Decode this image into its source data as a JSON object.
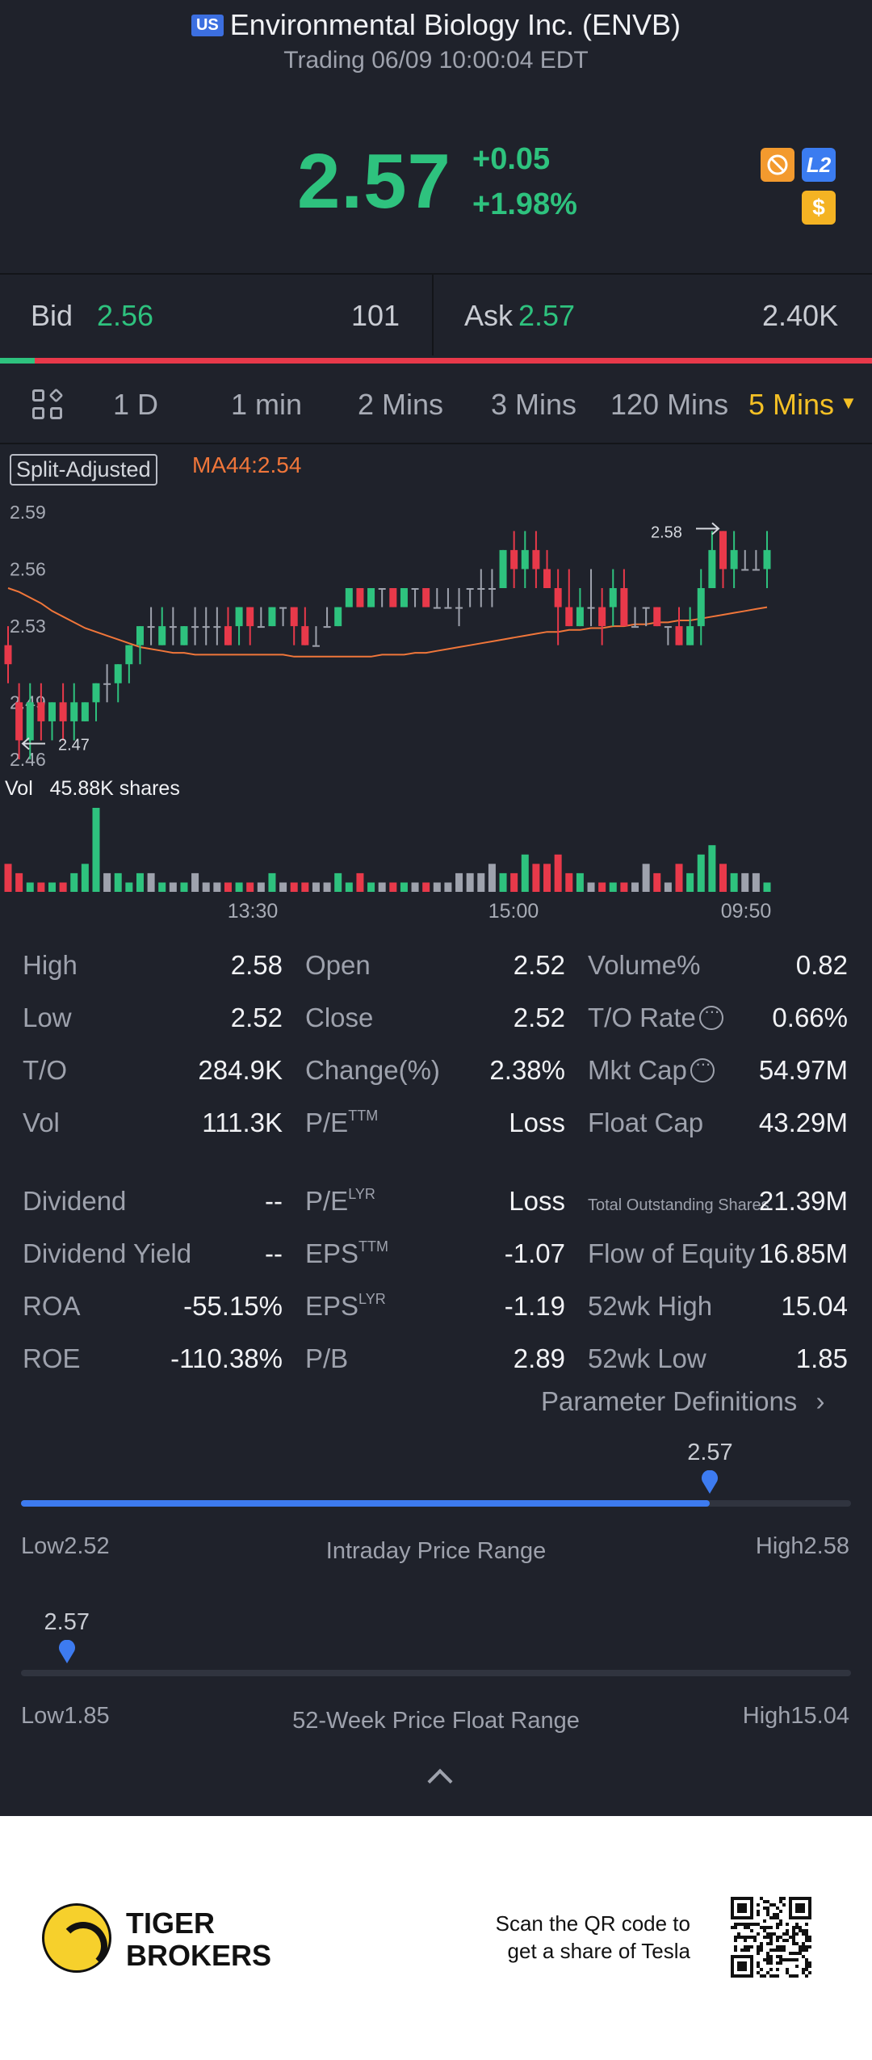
{
  "header": {
    "market_badge": "US",
    "title": "Environmental Biology Inc. (ENVB)",
    "status": "Trading 06/09 10:00:04 EDT"
  },
  "quote": {
    "price": "2.57",
    "change": "+0.05",
    "change_pct": "+1.98%",
    "badges": [
      "no-short-icon",
      "L2",
      "$"
    ],
    "colors": {
      "up": "#2ec27e",
      "down": "#e8394a",
      "accent": "#f4c025"
    }
  },
  "bid_ask": {
    "bid_label": "Bid",
    "bid_price": "2.56",
    "bid_size": "101",
    "ask_label": "Ask",
    "ask_price": "2.57",
    "ask_size": "2.40K",
    "bid_ratio": 0.04
  },
  "tabs": [
    {
      "label": "1 D",
      "active": false
    },
    {
      "label": "1 min",
      "active": false
    },
    {
      "label": "2 Mins",
      "active": false
    },
    {
      "label": "3 Mins",
      "active": false
    },
    {
      "label": "120 Mins",
      "active": false
    },
    {
      "label": "5 Mins",
      "active": true
    }
  ],
  "chart": {
    "split_label": "Split-Adjusted",
    "ma_label": "MA44:2.54",
    "vol_label": "Vol",
    "vol_value": "45.88K shares",
    "max_label": "2.58",
    "min_label": "2.47"
  },
  "chart_data": {
    "type": "candlestick",
    "y_ticks": [
      "2.59",
      "2.56",
      "2.53",
      "2.49",
      "2.46"
    ],
    "ylim": [
      2.46,
      2.595
    ],
    "x_ticks": [
      "13:30",
      "15:00",
      "09:50"
    ],
    "candles": [
      [
        2.52,
        2.51,
        2.53,
        2.5
      ],
      [
        2.49,
        2.47,
        2.5,
        2.46
      ],
      [
        2.47,
        2.49,
        2.5,
        2.46
      ],
      [
        2.49,
        2.48,
        2.5,
        2.47
      ],
      [
        2.48,
        2.49,
        2.49,
        2.47
      ],
      [
        2.49,
        2.48,
        2.5,
        2.47
      ],
      [
        2.48,
        2.49,
        2.5,
        2.47
      ],
      [
        2.48,
        2.49,
        2.49,
        2.48
      ],
      [
        2.49,
        2.5,
        2.5,
        2.48
      ],
      [
        2.5,
        2.5,
        2.51,
        2.49
      ],
      [
        2.5,
        2.51,
        2.51,
        2.49
      ],
      [
        2.51,
        2.52,
        2.52,
        2.5
      ],
      [
        2.52,
        2.53,
        2.53,
        2.51
      ],
      [
        2.53,
        2.53,
        2.54,
        2.52
      ],
      [
        2.52,
        2.53,
        2.54,
        2.52
      ],
      [
        2.53,
        2.53,
        2.54,
        2.52
      ],
      [
        2.52,
        2.53,
        2.53,
        2.52
      ],
      [
        2.53,
        2.53,
        2.54,
        2.52
      ],
      [
        2.53,
        2.53,
        2.54,
        2.52
      ],
      [
        2.53,
        2.53,
        2.54,
        2.52
      ],
      [
        2.53,
        2.52,
        2.54,
        2.52
      ],
      [
        2.53,
        2.54,
        2.54,
        2.52
      ],
      [
        2.54,
        2.53,
        2.54,
        2.52
      ],
      [
        2.53,
        2.53,
        2.54,
        2.53
      ],
      [
        2.53,
        2.54,
        2.54,
        2.53
      ],
      [
        2.54,
        2.54,
        2.54,
        2.53
      ],
      [
        2.54,
        2.53,
        2.54,
        2.52
      ],
      [
        2.53,
        2.52,
        2.54,
        2.52
      ],
      [
        2.52,
        2.52,
        2.53,
        2.52
      ],
      [
        2.53,
        2.53,
        2.54,
        2.53
      ],
      [
        2.53,
        2.54,
        2.54,
        2.53
      ],
      [
        2.54,
        2.55,
        2.55,
        2.54
      ],
      [
        2.55,
        2.54,
        2.55,
        2.54
      ],
      [
        2.54,
        2.55,
        2.55,
        2.54
      ],
      [
        2.55,
        2.55,
        2.55,
        2.54
      ],
      [
        2.55,
        2.54,
        2.55,
        2.54
      ],
      [
        2.54,
        2.55,
        2.55,
        2.54
      ],
      [
        2.55,
        2.55,
        2.55,
        2.54
      ],
      [
        2.55,
        2.54,
        2.55,
        2.54
      ],
      [
        2.54,
        2.54,
        2.55,
        2.54
      ],
      [
        2.54,
        2.54,
        2.55,
        2.54
      ],
      [
        2.54,
        2.54,
        2.55,
        2.53
      ],
      [
        2.55,
        2.55,
        2.55,
        2.54
      ],
      [
        2.55,
        2.55,
        2.56,
        2.54
      ],
      [
        2.55,
        2.55,
        2.56,
        2.54
      ],
      [
        2.55,
        2.57,
        2.57,
        2.55
      ],
      [
        2.57,
        2.56,
        2.58,
        2.55
      ],
      [
        2.56,
        2.57,
        2.58,
        2.55
      ],
      [
        2.57,
        2.56,
        2.58,
        2.55
      ],
      [
        2.56,
        2.55,
        2.57,
        2.55
      ],
      [
        2.55,
        2.54,
        2.56,
        2.52
      ],
      [
        2.54,
        2.53,
        2.56,
        2.53
      ],
      [
        2.53,
        2.54,
        2.55,
        2.53
      ],
      [
        2.54,
        2.54,
        2.56,
        2.53
      ],
      [
        2.54,
        2.53,
        2.55,
        2.52
      ],
      [
        2.54,
        2.55,
        2.56,
        2.53
      ],
      [
        2.55,
        2.53,
        2.56,
        2.53
      ],
      [
        2.53,
        2.53,
        2.54,
        2.53
      ],
      [
        2.54,
        2.54,
        2.54,
        2.53
      ],
      [
        2.54,
        2.53,
        2.54,
        2.53
      ],
      [
        2.53,
        2.53,
        2.53,
        2.52
      ],
      [
        2.53,
        2.52,
        2.54,
        2.52
      ],
      [
        2.52,
        2.53,
        2.54,
        2.52
      ],
      [
        2.53,
        2.55,
        2.56,
        2.52
      ],
      [
        2.55,
        2.57,
        2.58,
        2.55
      ],
      [
        2.58,
        2.56,
        2.58,
        2.55
      ],
      [
        2.56,
        2.57,
        2.58,
        2.55
      ],
      [
        2.56,
        2.56,
        2.57,
        2.56
      ],
      [
        2.56,
        2.56,
        2.57,
        2.56
      ],
      [
        2.56,
        2.57,
        2.58,
        2.55
      ]
    ],
    "ma": [
      2.55,
      2.548,
      2.545,
      2.542,
      2.538,
      2.535,
      2.532,
      2.529,
      2.527,
      2.525,
      2.523,
      2.521,
      2.519,
      2.518,
      2.517,
      2.516,
      2.516,
      2.515,
      2.515,
      2.515,
      2.515,
      2.515,
      2.515,
      2.515,
      2.515,
      2.515,
      2.514,
      2.514,
      2.514,
      2.514,
      2.514,
      2.514,
      2.514,
      2.514,
      2.515,
      2.515,
      2.515,
      2.516,
      2.516,
      2.517,
      2.518,
      2.519,
      2.52,
      2.521,
      2.522,
      2.523,
      2.524,
      2.525,
      2.526,
      2.527,
      2.527,
      2.528,
      2.528,
      2.529,
      2.529,
      2.53,
      2.53,
      2.531,
      2.531,
      2.532,
      2.532,
      2.533,
      2.533,
      2.534,
      2.535,
      2.536,
      2.537,
      2.538,
      2.539,
      2.54
    ],
    "volumes": [
      3,
      2,
      1,
      1,
      1,
      1,
      2,
      3,
      9,
      2,
      2,
      1,
      2,
      2,
      1,
      1,
      1,
      2,
      1,
      1,
      1,
      1,
      1,
      1,
      2,
      1,
      1,
      1,
      1,
      1,
      2,
      1,
      2,
      1,
      1,
      1,
      1,
      1,
      1,
      1,
      1,
      2,
      2,
      2,
      3,
      2,
      2,
      4,
      3,
      3,
      4,
      2,
      2,
      1,
      1,
      1,
      1,
      1,
      3,
      2,
      1,
      3,
      2,
      4,
      5,
      3,
      2,
      2,
      2,
      1
    ]
  },
  "stats": {
    "col1": [
      {
        "label": "High",
        "value": "2.58"
      },
      {
        "label": "Low",
        "value": "2.52"
      },
      {
        "label": "T/O",
        "value": "284.9K"
      },
      {
        "label": "Vol",
        "value": "111.3K"
      }
    ],
    "col2": [
      {
        "label": "Open",
        "value": "2.52"
      },
      {
        "label": "Close",
        "value": "2.52"
      },
      {
        "label": "Change(%)",
        "value": "2.38%"
      },
      {
        "label": "P/E",
        "sup": "TTM",
        "value": "Loss"
      }
    ],
    "col3": [
      {
        "label": "Volume%",
        "value": "0.82"
      },
      {
        "label": "T/O Rate",
        "value": "0.66%"
      },
      {
        "label": "Mkt Cap",
        "value": "54.97M"
      },
      {
        "label": "Float Cap",
        "value": "43.29M"
      }
    ],
    "col1b": [
      {
        "label": "Dividend",
        "value": "--"
      },
      {
        "label": "Dividend Yield",
        "value": "--"
      },
      {
        "label": "ROA",
        "value": "-55.15%"
      },
      {
        "label": "ROE",
        "value": "-110.38%"
      }
    ],
    "col2b": [
      {
        "label": "P/E",
        "sup": "LYR",
        "value": "Loss"
      },
      {
        "label": "EPS",
        "sup": "TTM",
        "value": "-1.07"
      },
      {
        "label": "EPS",
        "sup": "LYR",
        "value": "-1.19"
      },
      {
        "label": "P/B",
        "value": "2.89"
      }
    ],
    "col3b": [
      {
        "label": "Total Outstanding Shares",
        "value": "21.39M"
      },
      {
        "label": "Flow of Equity",
        "value": "16.85M"
      },
      {
        "label": "52wk High",
        "value": "15.04"
      },
      {
        "label": "52wk Low",
        "value": "1.85"
      }
    ],
    "param_link": "Parameter Definitions"
  },
  "ranges": {
    "intraday": {
      "current": "2.57",
      "low": "Low2.52",
      "high": "High2.58",
      "title": "Intraday Price Range",
      "position": 0.83
    },
    "week52": {
      "current": "2.57",
      "low": "Low1.85",
      "high": "High15.04",
      "title": "52-Week Price Float Range",
      "position": 0.055
    }
  },
  "footer": {
    "brand_line1": "TIGER",
    "brand_line2": "BROKERS",
    "scan_line1": "Scan the QR code to",
    "scan_line2": "get a share of Tesla"
  }
}
